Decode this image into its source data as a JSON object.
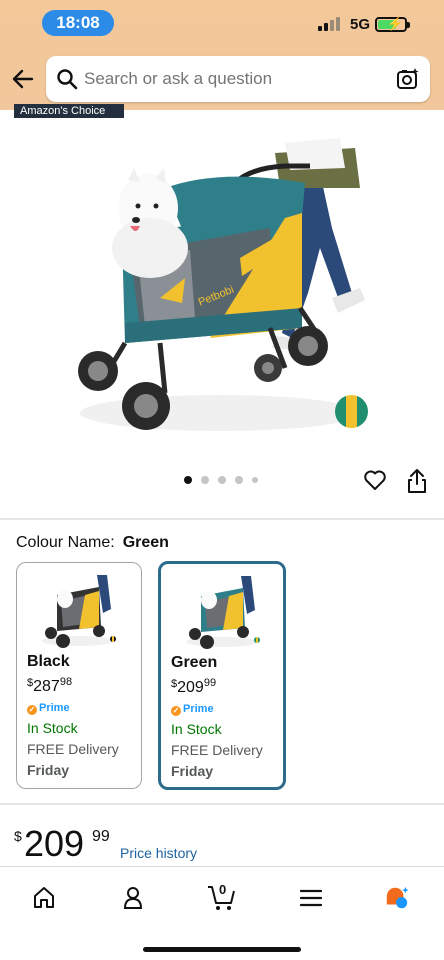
{
  "status_bar": {
    "time": "18:08",
    "network": "5G",
    "battery_level": 0.7
  },
  "header": {
    "search_placeholder": "Search or ask a question",
    "back_icon": "back-arrow-icon",
    "camera_icon": "camera-search-icon",
    "choice_badge": "Amazon's Choice"
  },
  "product": {
    "brand_text_on_image": "Petbobi",
    "image_count": 5,
    "active_image": 1
  },
  "colour": {
    "label": "Colour Name:",
    "selected": "Green"
  },
  "variants": [
    {
      "name": "Black",
      "currency": "$",
      "price_whole": "287",
      "price_cents": "98",
      "prime": "Prime",
      "stock": "In Stock",
      "delivery": "FREE Delivery",
      "day": "Friday",
      "selected": false
    },
    {
      "name": "Green",
      "currency": "$",
      "price_whole": "209",
      "price_cents": "99",
      "prime": "Prime",
      "stock": "In Stock",
      "delivery": "FREE Delivery",
      "day": "Friday",
      "selected": true
    }
  ],
  "price": {
    "currency": "$",
    "whole": "209",
    "cents": "99",
    "history_link": "Price history"
  },
  "bottom_nav": {
    "items": [
      "home-icon",
      "account-icon",
      "cart-icon",
      "menu-icon",
      "rufus-assistant-icon"
    ],
    "cart_count": "0"
  },
  "colors": {
    "header_bg": "#f1c79b",
    "stroller_teal": "#2f7f8a",
    "stroller_yellow": "#f2c12e",
    "link_blue": "#2162a1",
    "stock_green": "#007600",
    "selected_border": "#2d6b8a"
  }
}
